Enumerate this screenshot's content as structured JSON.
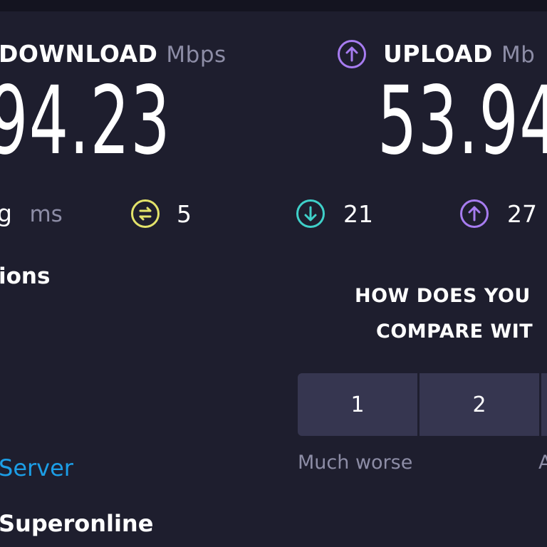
{
  "download": {
    "label": "DOWNLOAD",
    "unit": "Mbps",
    "value": "94.23"
  },
  "upload": {
    "label": "UPLOAD",
    "unit": "Mb",
    "value": "53.94"
  },
  "latency": {
    "ping_label": "g",
    "ping_unit": "ms",
    "unloaded": "5",
    "download": "21",
    "upload": "27"
  },
  "connections": {
    "title": "ions"
  },
  "server": {
    "link_label": "Server"
  },
  "isp": {
    "name": "Superonline"
  },
  "survey": {
    "question_line1": "HOW DOES YOU",
    "question_line2": "COMPARE WIT",
    "options": [
      "1",
      "2"
    ],
    "caption_low": "Much worse",
    "caption_next": "A"
  },
  "colors": {
    "background": "#1e1e2e",
    "upload_accent": "#a77cf0",
    "download_accent": "#3fd0c9",
    "ping_accent": "#e3e36a",
    "link": "#1c9ee6"
  }
}
